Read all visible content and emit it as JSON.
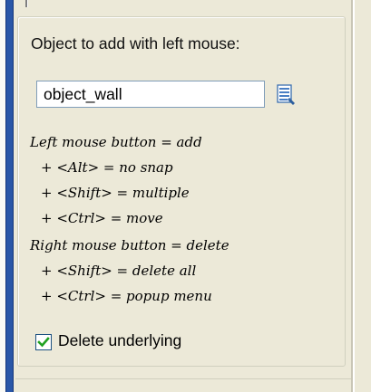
{
  "colors": {
    "window_frame": "#2a57a8",
    "panel_background": "#ece9d8",
    "checkbox_check": "#21a121",
    "input_border": "#7f9db9"
  },
  "object_picker": {
    "heading": "Object to add with left mouse:",
    "input_value": "object_wall",
    "browse_icon": "document-list-icon"
  },
  "mouse_help": {
    "left_button": "Left mouse button = add",
    "alt_modifier": "+ <Alt> = no snap",
    "shift_modifier": "+ <Shift> = multiple",
    "ctrl_modifier": "+ <Ctrl> = move",
    "right_button": "Right mouse button = delete",
    "right_shift_modifier": "+ <Shift> = delete all",
    "right_ctrl_modifier": "+ <Ctrl> = popup menu"
  },
  "options": {
    "delete_underlying_label": "Delete underlying",
    "delete_underlying_checked": true
  }
}
